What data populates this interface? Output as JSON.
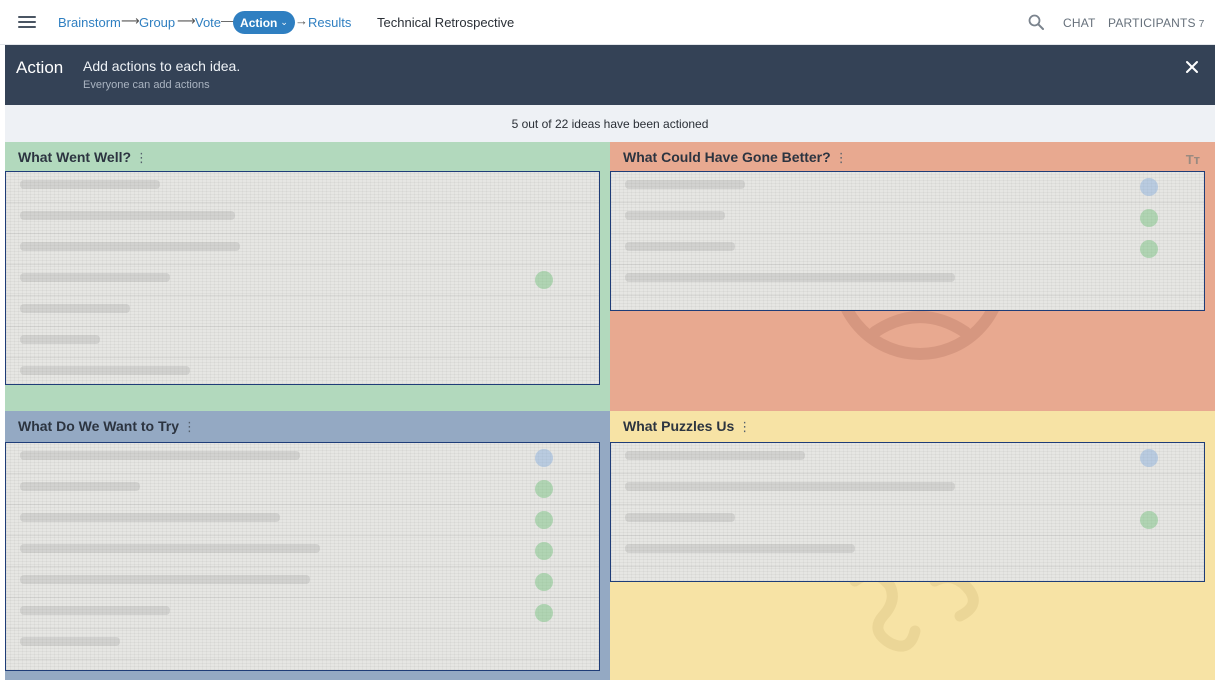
{
  "nav": {
    "steps": [
      {
        "label": "Brainstorm"
      },
      {
        "label": "Group"
      },
      {
        "label": "Vote"
      },
      {
        "label": "Action"
      },
      {
        "label": "Results"
      }
    ],
    "session_title": "Technical Retrospective",
    "chat_label": "CHAT",
    "participants_label": "PARTICIPANTS",
    "participants_count": "7"
  },
  "banner": {
    "title": "Action",
    "message": "Add actions to each idea.",
    "sub": "Everyone can add actions"
  },
  "progress_text": "5 out of 22 ideas have been actioned",
  "columns": [
    {
      "title": "What Went Well?",
      "color": "#b2d9bd"
    },
    {
      "title": "What Could Have Gone Better?",
      "color": "#e8a990"
    },
    {
      "title": "What Do We Want to Try",
      "color": "#94a9c3"
    },
    {
      "title": "What Puzzles Us",
      "color": "#f7e3a5"
    }
  ],
  "text_size_label": "Tт",
  "colors": {
    "accent": "#2f7fc1",
    "banner": "#344256",
    "card_border": "#1f3d78"
  }
}
